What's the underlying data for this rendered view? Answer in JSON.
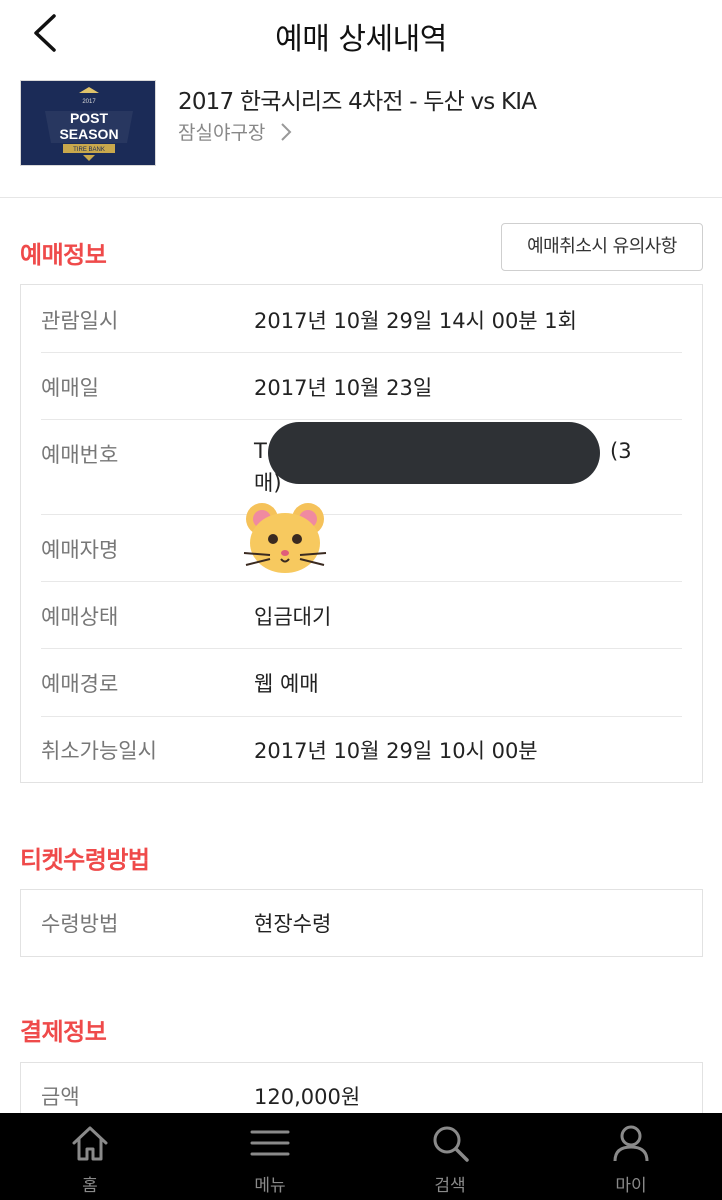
{
  "header": {
    "title": "예매 상세내역"
  },
  "event": {
    "title": "2017 한국시리즈 4차전 - 두산 vs KIA",
    "venue": "잠실야구장",
    "thumbnail": {
      "year": "2017",
      "line1": "POST",
      "line2": "SEASON",
      "sponsor": "TIRE BANK"
    }
  },
  "reservation": {
    "section_title": "예매정보",
    "notice_button": "예매취소시 유의사항",
    "rows": [
      {
        "label": "관람일시",
        "value": "2017년 10월 29일 14시 00분 1회"
      },
      {
        "label": "예매일",
        "value": "2017년 10월 23일"
      },
      {
        "label": "예매번호",
        "value_prefix": "T",
        "value_suffix": "(3",
        "value_line2": "매)"
      },
      {
        "label": "예매자명",
        "value": ""
      },
      {
        "label": "예매상태",
        "value": "입금대기"
      },
      {
        "label": "예매경로",
        "value": "웹 예매"
      },
      {
        "label": "취소가능일시",
        "value": "2017년 10월 29일 10시 00분"
      }
    ]
  },
  "ticket": {
    "section_title": "티켓수령방법",
    "rows": [
      {
        "label": "수령방법",
        "value": "현장수령"
      }
    ]
  },
  "payment": {
    "section_title": "결제정보",
    "rows": [
      {
        "label": "금액",
        "value": "120,000원"
      }
    ]
  },
  "nav": {
    "items": [
      {
        "label": "홈",
        "icon": "home-icon"
      },
      {
        "label": "메뉴",
        "icon": "menu-icon"
      },
      {
        "label": "검색",
        "icon": "search-icon"
      },
      {
        "label": "마이",
        "icon": "user-icon"
      }
    ]
  },
  "colors": {
    "accent": "#ef4a4a",
    "nav_bg": "#000000",
    "redaction": "#2e3135"
  }
}
